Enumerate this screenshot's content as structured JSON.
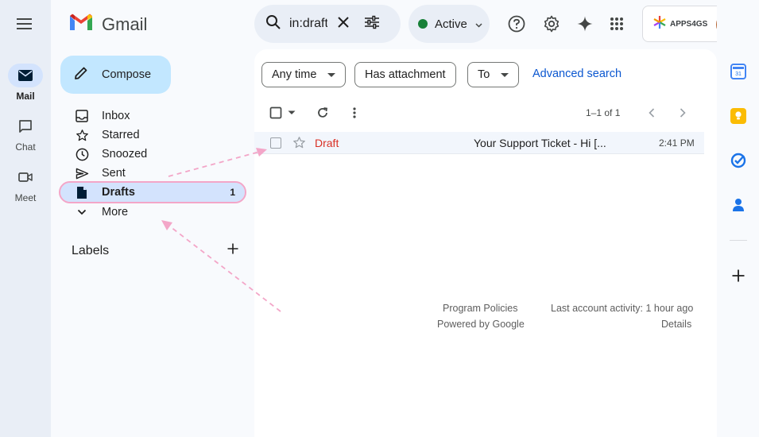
{
  "app": {
    "name": "Gmail"
  },
  "rail": {
    "items": [
      {
        "label": "Mail",
        "icon": "mail-icon",
        "active": true
      },
      {
        "label": "Chat",
        "icon": "chat-icon",
        "active": false
      },
      {
        "label": "Meet",
        "icon": "meet-icon",
        "active": false
      }
    ]
  },
  "compose": {
    "label": "Compose"
  },
  "nav": {
    "items": [
      {
        "label": "Inbox",
        "icon": "inbox-icon",
        "count": ""
      },
      {
        "label": "Starred",
        "icon": "star-icon",
        "count": ""
      },
      {
        "label": "Snoozed",
        "icon": "clock-icon",
        "count": ""
      },
      {
        "label": "Sent",
        "icon": "send-icon",
        "count": ""
      },
      {
        "label": "Drafts",
        "icon": "draft-icon",
        "count": "1"
      },
      {
        "label": "More",
        "icon": "chevron-down-icon",
        "count": ""
      }
    ],
    "labels_title": "Labels"
  },
  "search": {
    "value": "in:draft"
  },
  "status": {
    "label": "Active",
    "color": "#188038"
  },
  "account": {
    "name": "APPS4GS"
  },
  "filters": {
    "chips": [
      "Any time",
      "Has attachment",
      "To"
    ],
    "advanced": "Advanced search"
  },
  "toolbar": {
    "range": "1–1 of 1"
  },
  "messages": [
    {
      "sender": "Draft",
      "subject": "Your Support Ticket - Hi [...",
      "time": "2:41 PM"
    }
  ],
  "footer": {
    "policies": "Program Policies",
    "powered": "Powered by Google",
    "activity": "Last account activity: 1 hour ago",
    "details": "Details"
  },
  "colors": {
    "accent": "#0b57d0",
    "compose_bg": "#c2e7ff",
    "active_nav": "#d3e3fd",
    "draft_red": "#d93025",
    "highlight_pink": "#f3a6c8"
  }
}
